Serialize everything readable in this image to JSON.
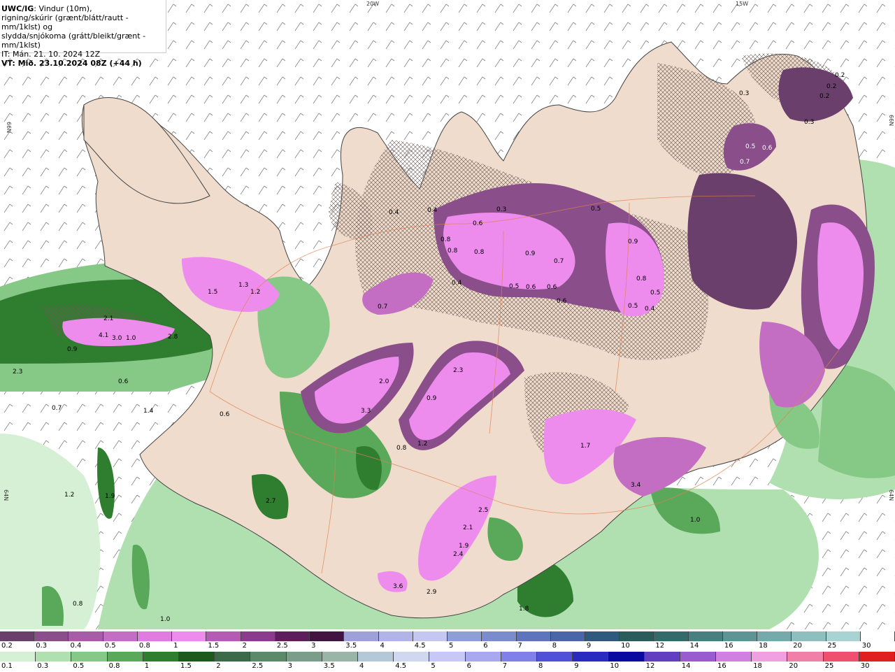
{
  "header": {
    "line1_bold": "UWC/IG",
    "line1_rest": ": Vindur (10m),",
    "line2": "rigning/skúrir (grænt/blátt/rautt - mm/1klst) og",
    "line3": "slydda/snjókoma (grátt/bleikt/grænt - mm/1klst)",
    "line4": "IT: Mán. 21. 10. 2024 12Z",
    "line5": "VT: Mið. 23.10.2024 08Z (+44 h)"
  },
  "coords": {
    "lon_20w": "20W",
    "lon_15w": "15W",
    "lat_66n_left": "66N",
    "lat_66n_right": "66N",
    "lat_64n_left": "64N",
    "lat_64n_right": "64N"
  },
  "map_values": [
    "0.2",
    "0.2",
    "0.2",
    "0.3",
    "0.3",
    "0.5",
    "0.6",
    "0.7",
    "0.4",
    "0.4",
    "0.3",
    "0.5",
    "0.6",
    "0.8",
    "0.8",
    "0.8",
    "0.9",
    "0.7",
    "0.4",
    "0.5",
    "0.6",
    "0.6",
    "0.6",
    "0.7",
    "0.9",
    "0.8",
    "0.5",
    "0.4",
    "0.5",
    "1.3",
    "1.2",
    "1.5",
    "2.1",
    "2.3",
    "4.1",
    "3.0",
    "1.0",
    "2.8",
    "0.9",
    "2.0",
    "3.3",
    "2.3",
    "0.9",
    "1.2",
    "0.8",
    "1.7",
    "3.4",
    "2.5",
    "2.1",
    "1.9",
    "2.4",
    "2.9",
    "3.6",
    "1.8",
    "1.0",
    "2.7",
    "1.4",
    "1.9",
    "1.2",
    "0.8",
    "1.0",
    "0.6",
    "0.7",
    "0.6"
  ],
  "legend_snow": {
    "labels": [
      "0.2",
      "0.3",
      "0.4",
      "0.5",
      "0.8",
      "1",
      "1.5",
      "2",
      "2.5",
      "3",
      "3.5",
      "4",
      "4.5",
      "5",
      "6",
      "7",
      "8",
      "9",
      "10",
      "12",
      "14",
      "16",
      "18",
      "20",
      "25",
      "30"
    ],
    "colors": [
      "#6b3f6b",
      "#8a4f8a",
      "#a65ca6",
      "#c36ec3",
      "#e07be0",
      "#ee8cee",
      "#b45bb4",
      "#8b3b8b",
      "#5c1f5c",
      "#421442",
      "#9ea0d8",
      "#b0b4e6",
      "#c4c8f0",
      "#8e9fd6",
      "#7a8ccc",
      "#5e74bc",
      "#4a66a8",
      "#2f5a7e",
      "#2b5c5c",
      "#356a6a",
      "#4a7f7f",
      "#5e9494",
      "#76aaaa",
      "#8fbebe",
      "#a9d2d2",
      "#ffffff"
    ]
  },
  "legend_rain": {
    "labels": [
      "0.1",
      "0.3",
      "0.5",
      "0.8",
      "1",
      "1.5",
      "2",
      "2.5",
      "3",
      "3.5",
      "4",
      "4.5",
      "5",
      "6",
      "7",
      "8",
      "9",
      "10",
      "12",
      "14",
      "16",
      "18",
      "20",
      "25",
      "30"
    ],
    "colors": [
      "#d6f0d6",
      "#b0e0b0",
      "#86c886",
      "#5aa85a",
      "#2f7d2f",
      "#1c5a1c",
      "#3a6a4a",
      "#5a8a6a",
      "#7a9e8a",
      "#9ab4a8",
      "#b4c8d8",
      "#cfd8f0",
      "#c8c8f8",
      "#a8a8f0",
      "#8080e8",
      "#5050d8",
      "#2a2ac0",
      "#0a0aa0",
      "#6040c0",
      "#9a5ad0",
      "#d080e0",
      "#f0a0e0",
      "#f080a8",
      "#f05070",
      "#e02020"
    ]
  }
}
